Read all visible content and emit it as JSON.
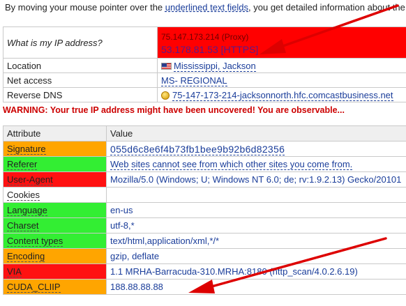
{
  "intro": {
    "text_before": "By moving your mouse pointer over the ",
    "link": "underlined text fields",
    "text_after": ", you get detailed information about the"
  },
  "ip_info": {
    "ip_label": "What is my IP address?",
    "ip_proxy": "75.147.173.214 (Proxy)",
    "ip_https": "53.178.81.53 [HTTPS]",
    "rows": [
      {
        "label": "Location",
        "value": "Mississippi, Jackson",
        "icon": "us-flag-icon"
      },
      {
        "label": "Net access",
        "value": "MS- REGIONAL",
        "icon": ""
      },
      {
        "label": "Reverse DNS",
        "value": "75-147-173-214-jacksonnorth.hfc.comcastbusiness.net",
        "icon": "coin-icon"
      }
    ]
  },
  "warning": "WARNING: Your true IP address might have been uncovered! You are observable...",
  "attributes": {
    "header": {
      "attribute": "Attribute",
      "value": "Value"
    },
    "rows": [
      {
        "attribute": "Signature",
        "value": "055d6c8e6f4b73fb1bee9b92b6d82356",
        "status": "orange"
      },
      {
        "attribute": "Referer",
        "value": "Web sites cannot see from which other sites you come from.",
        "status": "green"
      },
      {
        "attribute": "User-Agent",
        "value": "Mozilla/5.0 (Windows; U; Windows NT 6.0; de; rv:1.9.2.13) Gecko/20101",
        "status": "red"
      },
      {
        "attribute": "Cookies",
        "value": "",
        "status": "white"
      },
      {
        "attribute": "Language",
        "value": "en-us",
        "status": "green"
      },
      {
        "attribute": "Charset",
        "value": "utf-8,*",
        "status": "green"
      },
      {
        "attribute": "Content types",
        "value": "text/html,application/xml,*/*",
        "status": "green"
      },
      {
        "attribute": "Encoding",
        "value": "gzip, deflate",
        "status": "orange"
      },
      {
        "attribute": "VIA",
        "value": "1.1 MRHA-Barracuda-310.MRHA:8180 (http_scan/4.0.2.6.19)",
        "status": "red"
      },
      {
        "attribute": "CUDA_CLIIP",
        "value": "188.88.88.88",
        "status": "orange"
      }
    ]
  },
  "colors": {
    "orange": "#ffa500",
    "green": "#33ee33",
    "red": "#ff1111",
    "link": "#1a3d9a",
    "warning": "#cc0000",
    "arrow": "#dd0000"
  }
}
